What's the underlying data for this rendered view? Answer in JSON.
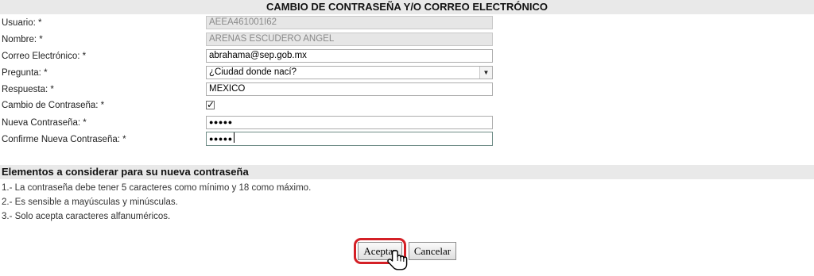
{
  "form": {
    "title": "CAMBIO DE CONTRASEÑA Y/O CORREO ELECTRÓNICO",
    "fields": [
      {
        "label": "Usuario: *",
        "value": "AEEA461001I62"
      },
      {
        "label": "Nombre: *",
        "value": "ARENAS ESCUDERO ANGEL"
      },
      {
        "label": "Correo Electrónico: *",
        "value": "abrahama@sep.gob.mx"
      },
      {
        "label": "Pregunta: *",
        "value": "¿Ciudad donde nací?"
      },
      {
        "label": "Respuesta: *",
        "value": "MEXICO"
      },
      {
        "label": "Cambio de Contraseña: *",
        "value": "✓"
      },
      {
        "label": "Nueva Contraseña: *",
        "value": "●●●●●"
      },
      {
        "label": "Confirme Nueva Contraseña: *",
        "value": "●●●●●"
      }
    ]
  },
  "rules": {
    "title": "Elementos a considerar para su nueva contraseña",
    "items": [
      "1.- La contraseña debe tener 5 caracteres como mínimo y 18 como máximo.",
      "2.- Es sensible a mayúsculas y minúsculas.",
      "3.- Solo acepta caracteres alfanuméricos."
    ]
  },
  "buttons": {
    "accept_label": "Aceptar",
    "cancel_label": "Cancelar"
  },
  "icons": {
    "select_arrow": "chevron-down-icon",
    "checkbox_mark": "checkmark-icon",
    "cursor": "hand-pointer-icon"
  },
  "colors": {
    "header_bg": "#e9e9e9",
    "highlight": "#d42026",
    "disabled_bg": "#e6e6e6"
  }
}
